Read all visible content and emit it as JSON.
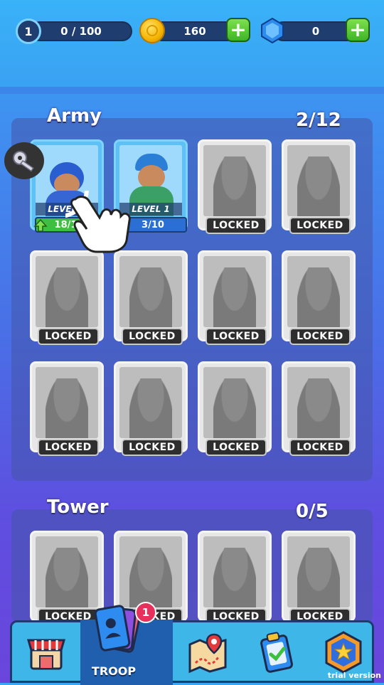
{
  "hud": {
    "level": "1",
    "xp": "0 / 100",
    "coins": "160",
    "gems": "0"
  },
  "army": {
    "title": "Army",
    "count": "2/12",
    "owned": [
      {
        "level_label": "LEVEL 1",
        "progress": "18/10",
        "upgradable": true
      },
      {
        "level_label": "LEVEL 1",
        "progress": "3/10",
        "upgradable": false
      }
    ],
    "locked_label": "LOCKED"
  },
  "tower": {
    "title": "Tower",
    "count": "0/5",
    "locked_label": "LOCKED"
  },
  "nav": {
    "troop_label": "TROOP",
    "troop_badge": "1"
  },
  "watermark": "trial version",
  "colors": {
    "accent_green": "#3fbf3f",
    "accent_blue": "#2b6fd6",
    "badge_red": "#e5315b"
  }
}
